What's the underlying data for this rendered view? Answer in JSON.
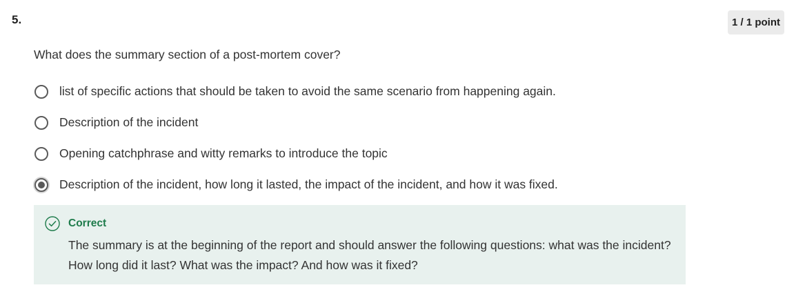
{
  "question": {
    "number": "5.",
    "score": "1 / 1 point",
    "text": "What does the summary section of a post-mortem cover?",
    "options": [
      {
        "label": "list of specific actions that should be taken to avoid the same scenario from happening again.",
        "selected": false
      },
      {
        "label": "Description of the incident",
        "selected": false
      },
      {
        "label": "Opening catchphrase and witty remarks to introduce the topic",
        "selected": false
      },
      {
        "label": "Description of the incident, how long it lasted, the impact of the incident, and how it was fixed.",
        "selected": true
      }
    ]
  },
  "feedback": {
    "status": "Correct",
    "icon": "check-circle-icon",
    "explanation": "The summary is at the beginning of the report and should answer the following questions: what was the incident? How long did it last? What was the impact? And how was it fixed?"
  },
  "colors": {
    "correct_green": "#1e7b4b",
    "feedback_background": "#e8f1ee",
    "badge_background": "#ebebeb"
  }
}
